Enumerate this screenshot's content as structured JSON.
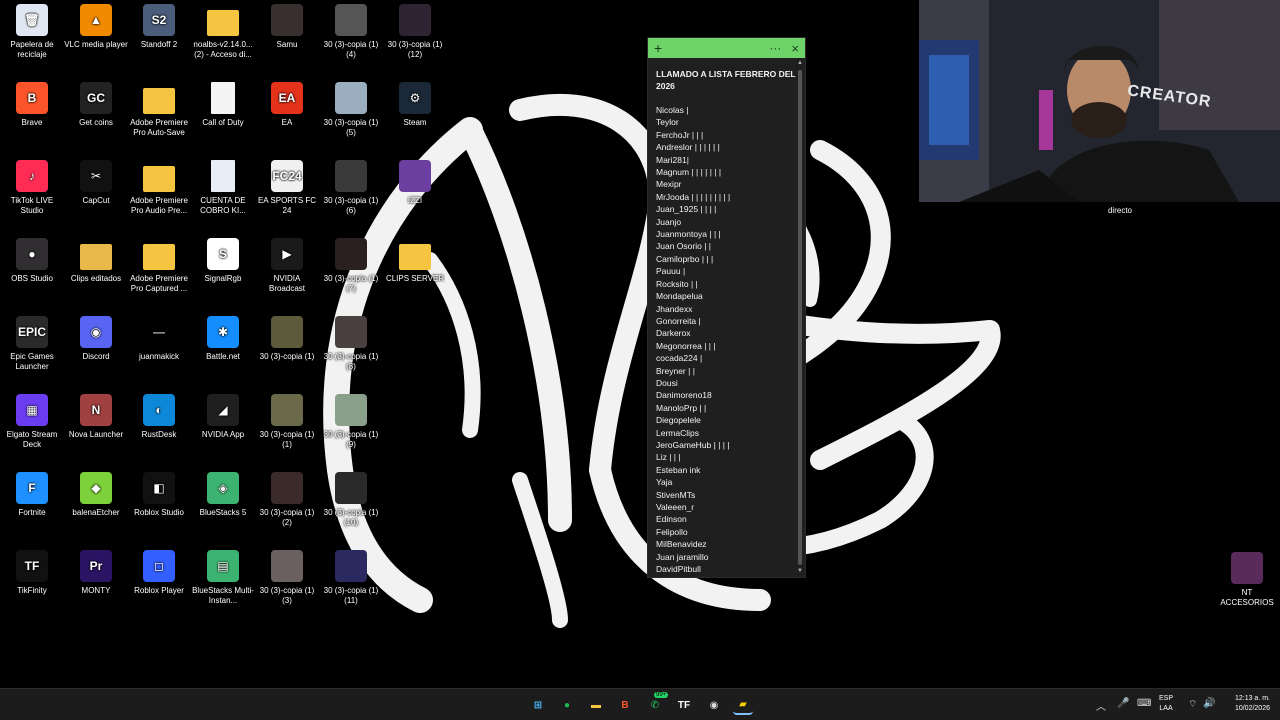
{
  "desktop": {
    "icons": [
      {
        "label": "Papelera de reciclaje",
        "icon": "recycle-bin-icon",
        "color": "#dfe8f2"
      },
      {
        "label": "VLC media player",
        "icon": "vlc-icon",
        "color": "#f18a00"
      },
      {
        "label": "Standoff 2",
        "icon": "standoff-icon",
        "color": "#4a5d7a"
      },
      {
        "label": "noalbs-v2.14.0... (2) - Acceso di...",
        "icon": "folder-icon",
        "color": "#f5c542"
      },
      {
        "label": "Samu",
        "icon": "image-file-icon",
        "color": "#3a2f2f"
      },
      {
        "label": "30 (3)-copia (1)(4)",
        "icon": "image-file-icon",
        "color": "#555"
      },
      {
        "label": "30 (3)-copia (1)(12)",
        "icon": "image-file-icon",
        "color": "#2e2333"
      },
      {
        "label": "Brave",
        "icon": "brave-icon",
        "color": "#fb542b"
      },
      {
        "label": "Get coins",
        "icon": "getcoins-icon",
        "color": "#222"
      },
      {
        "label": "Adobe Premiere Pro Auto-Save",
        "icon": "folder-icon",
        "color": "#f5c542"
      },
      {
        "label": "Call of Duty",
        "icon": "document-icon",
        "color": "#f4f4f4"
      },
      {
        "label": "EA",
        "icon": "ea-icon",
        "color": "#e4321b"
      },
      {
        "label": "30 (3)-copia (1)(5)",
        "icon": "image-file-icon",
        "color": "#9aaec0"
      },
      {
        "label": "Steam",
        "icon": "steam-icon",
        "color": "#1b2838"
      },
      {
        "label": "TikTok LIVE Studio",
        "icon": "tiktok-icon",
        "color": "#fe2c55"
      },
      {
        "label": "CapCut",
        "icon": "capcut-icon",
        "color": "#111"
      },
      {
        "label": "Adobe Premiere Pro Audio Pre...",
        "icon": "folder-icon",
        "color": "#f5c542"
      },
      {
        "label": "CUENTA DE COBRO KI...",
        "icon": "document-icon",
        "color": "#e8eef7"
      },
      {
        "label": "EA SPORTS FC 24",
        "icon": "fc24-icon",
        "color": "#f0f0f0"
      },
      {
        "label": "30 (3)-copia (1)(6)",
        "icon": "image-file-icon",
        "color": "#3a3a3a"
      },
      {
        "label": "IZZI",
        "icon": "image-file-icon",
        "color": "#6a3fa0"
      },
      {
        "label": "OBS Studio",
        "icon": "obs-icon",
        "color": "#302e31"
      },
      {
        "label": "Clips editados",
        "icon": "folder-icon",
        "color": "#e8b84a"
      },
      {
        "label": "Adobe Premiere Pro Captured ...",
        "icon": "folder-icon",
        "color": "#f5c542"
      },
      {
        "label": "SignalRgb",
        "icon": "signalrgb-icon",
        "color": "#fff"
      },
      {
        "label": "NVIDIA Broadcast",
        "icon": "nvidia-broadcast-icon",
        "color": "#1a1a1a"
      },
      {
        "label": "30 (3)-copia (1)(7)",
        "icon": "image-file-icon",
        "color": "#2a2020"
      },
      {
        "label": "CLIPS SERVER",
        "icon": "folder-icon",
        "color": "#f5c542"
      },
      {
        "label": "Epic Games Launcher",
        "icon": "epic-games-icon",
        "color": "#2a2a2a"
      },
      {
        "label": "Discord",
        "icon": "discord-icon",
        "color": "#5865f2"
      },
      {
        "label": "juanmakick",
        "icon": "file-icon",
        "color": "#000"
      },
      {
        "label": "Battle.net",
        "icon": "battlenet-icon",
        "color": "#148eff"
      },
      {
        "label": "30 (3)-copia (1)",
        "icon": "image-file-icon",
        "color": "#5b5a3a"
      },
      {
        "label": "30 (3)-copia (1)(8)",
        "icon": "image-file-icon",
        "color": "#4a4040"
      },
      {
        "label": "Elgato Stream Deck",
        "icon": "streamdeck-icon",
        "color": "#6b3df0"
      },
      {
        "label": "Nova Launcher",
        "icon": "nova-icon",
        "color": "#a04040"
      },
      {
        "label": "RustDesk",
        "icon": "rustdesk-icon",
        "color": "#0d87d8"
      },
      {
        "label": "NVIDIA App",
        "icon": "nvidia-icon",
        "color": "#1f1f1f"
      },
      {
        "label": "30 (3)-copia (1)(1)",
        "icon": "image-file-icon",
        "color": "#6a6a4a"
      },
      {
        "label": "30 (3)-copia (1)(9)",
        "icon": "image-file-icon",
        "color": "#8aa08a"
      },
      {
        "label": "Fortnite",
        "icon": "fortnite-icon",
        "color": "#1e90ff"
      },
      {
        "label": "balenaEtcher",
        "icon": "balena-icon",
        "color": "#7fd13b"
      },
      {
        "label": "Roblox Studio",
        "icon": "roblox-studio-icon",
        "color": "#111"
      },
      {
        "label": "BlueStacks 5",
        "icon": "bluestacks-icon",
        "color": "#3cb371"
      },
      {
        "label": "30 (3)-copia (1)(2)",
        "icon": "image-file-icon",
        "color": "#3a2a2a"
      },
      {
        "label": "30 (3)-copia (1)(10)",
        "icon": "image-file-icon",
        "color": "#2a2a2a"
      },
      {
        "label": "TikFinity",
        "icon": "tikfinity-icon",
        "color": "#111"
      },
      {
        "label": "MONTY",
        "icon": "premiere-icon",
        "color": "#2a1463"
      },
      {
        "label": "Roblox Player",
        "icon": "roblox-icon",
        "color": "#335fff"
      },
      {
        "label": "BlueStacks Multi-Instan...",
        "icon": "bluestacks-multi-icon",
        "color": "#3cb371"
      },
      {
        "label": "30 (3)-copia (1)(3)",
        "icon": "image-file-icon",
        "color": "#6a6060"
      },
      {
        "label": "30 (3)-copia (1)(11)",
        "icon": "image-file-icon",
        "color": "#2a2a60"
      }
    ],
    "right_icon": {
      "label": "NT ACCESORIOS",
      "icon": "image-file-icon",
      "color": "#5a2a5a"
    },
    "icon_abbr": {
      "recycle-bin-icon": "🗑",
      "vlc-icon": "▲",
      "standoff-icon": "S2",
      "folder-icon": "",
      "image-file-icon": "",
      "brave-icon": "B",
      "getcoins-icon": "GC",
      "document-icon": "",
      "ea-icon": "EA",
      "steam-icon": "⚙",
      "tiktok-icon": "♪",
      "capcut-icon": "✂",
      "fc24-icon": "FC24",
      "obs-icon": "●",
      "signalrgb-icon": "S",
      "nvidia-broadcast-icon": "▶",
      "epic-games-icon": "EPIC",
      "discord-icon": "◉",
      "file-icon": "—",
      "battlenet-icon": "✱",
      "streamdeck-icon": "▦",
      "nova-icon": "N",
      "rustdesk-icon": "◐",
      "nvidia-icon": "◢",
      "fortnite-icon": "F",
      "balena-icon": "◆",
      "roblox-studio-icon": "◧",
      "bluestacks-icon": "◈",
      "tikfinity-icon": "TF",
      "premiere-icon": "Pr",
      "roblox-icon": "◻",
      "bluestacks-multi-icon": "▤"
    }
  },
  "sticky_note": {
    "add_label": "+",
    "menu_label": "···",
    "close_label": "×",
    "title": "LLAMADO A LISTA FEBRERO DEL 2026",
    "lines": [
      "Nicolas |",
      "Teylor",
      "FerchoJr | | |",
      "Andreslor | | | | | |",
      "Mari281|",
      "Magnum | | | | | | |",
      "Mexipr",
      "MrJooda | | | | | | | | |",
      "Juan_1925 | | | |",
      "Juanjo",
      "Juanmontoya | | |",
      "Juan Osorio | |",
      "Camiloprbo | | |",
      "Pauuu |",
      "Rocksito | |",
      "Mondapelua",
      "Jhandexx",
      "Gonorreita |",
      "Darkerox",
      "Megonorrea | | |",
      "cocada224 |",
      "Breyner | |",
      "Dousi",
      "Danimoreno18",
      "ManoloPrp | |",
      "Diegopelele",
      "LermaClips",
      "JeroGameHub | | | |",
      "Liz | | |",
      "Esteban ink",
      "Yaja",
      "StivenMTs",
      "Valeeen_r",
      "Edinson",
      "Felipollo",
      "MilBenavidez",
      "Juan jaramillo",
      "DavidPitbull"
    ]
  },
  "webcam": {
    "label": "directo",
    "hoodie_text": "CREATOR"
  },
  "taskbar": {
    "apps": [
      {
        "icon": "windows-start-icon",
        "glyph": "⊞",
        "color": "#4cc2ff"
      },
      {
        "icon": "spotify-icon",
        "glyph": "●",
        "color": "#1db954"
      },
      {
        "icon": "file-explorer-icon",
        "glyph": "▬",
        "color": "#f5c542"
      },
      {
        "icon": "brave-icon",
        "glyph": "B",
        "color": "#fb542b"
      },
      {
        "icon": "whatsapp-icon",
        "glyph": "✆",
        "color": "#25d366"
      },
      {
        "icon": "tikfinity-icon",
        "glyph": "TF",
        "color": "#fff"
      },
      {
        "icon": "obs-icon",
        "glyph": "◉",
        "color": "#ddd"
      },
      {
        "icon": "sticky-notes-icon",
        "glyph": "▰",
        "color": "#f7d000"
      }
    ],
    "whatsapp_badge": "99+",
    "language": "ESP",
    "language_sub": "LAA",
    "time": "12:13 a. m.",
    "date": "10/02/2026"
  },
  "colors": {
    "sticky_header": "#6ed46a",
    "sticky_body": "#1f1f1f",
    "taskbar": "#1c1c1c"
  }
}
